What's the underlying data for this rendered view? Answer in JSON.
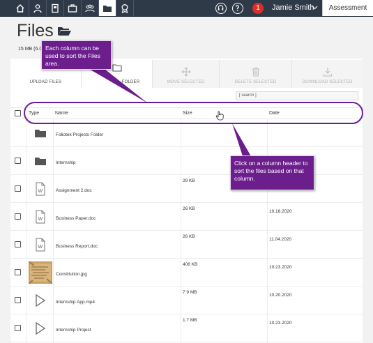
{
  "nav": {
    "items": [
      {
        "name": "home-icon"
      },
      {
        "name": "profile-icon"
      },
      {
        "name": "portfolio-book-icon"
      },
      {
        "name": "briefcase-icon"
      },
      {
        "name": "groups-icon"
      },
      {
        "name": "folder-icon",
        "active": true
      },
      {
        "name": "award-icon"
      }
    ],
    "help_icons": [
      "headset-icon",
      "help-icon"
    ],
    "notification_count": "1",
    "user_name": "Jamie Smith",
    "assessment_tab": "Assessment",
    "bar_color": "#2f3a49"
  },
  "page": {
    "title": "Files",
    "quota": "15 MB (6.0"
  },
  "toolbar": {
    "upload": "UPLOAD FILES",
    "new_folder": "FOLDER",
    "move": "MOVE SELECTED",
    "delete": "DELETE SELECTED",
    "download": "DOWNLOAD SELECTED"
  },
  "search": {
    "placeholder": "[ search ]"
  },
  "table": {
    "headers": {
      "type": "Type",
      "name": "Name",
      "size": "Size",
      "date": "Date"
    },
    "rows": [
      {
        "icon": "folder-icon",
        "name": "Foliotek Projects Folder",
        "size": "",
        "date": "",
        "has_checkbox": false
      },
      {
        "icon": "folder-icon",
        "name": "Internship",
        "size": "",
        "date": "",
        "has_checkbox": true
      },
      {
        "icon": "word-doc-icon",
        "name": "Assignment 2.doc",
        "size": "29 KB",
        "date": "",
        "has_checkbox": true
      },
      {
        "icon": "word-doc-icon",
        "name": "Business Paper.doc",
        "size": "26 KB",
        "date": "10.16.2020",
        "has_checkbox": true
      },
      {
        "icon": "word-doc-icon",
        "name": "Business Report.doc",
        "size": "26 KB",
        "date": "11.04.2020",
        "has_checkbox": true
      },
      {
        "icon": "image-thumbnail",
        "name": "Constitution.jpg",
        "size": "406 KB",
        "date": "10.23.2020",
        "has_checkbox": true
      },
      {
        "icon": "video-play-icon",
        "name": "Internship App.mp4",
        "size": "7.9 MB",
        "date": "10.20.2020",
        "has_checkbox": true
      },
      {
        "icon": "video-play-icon",
        "name": "Internship Project",
        "size": "1.7 MB",
        "date": "10.23.2020",
        "has_checkbox": true
      }
    ]
  },
  "callouts": {
    "sort_tip": "Each column can be used to sort the Files area.",
    "header_tip": "Click on a column header to sort the files based on that column.",
    "color": "#6b1e8c"
  }
}
